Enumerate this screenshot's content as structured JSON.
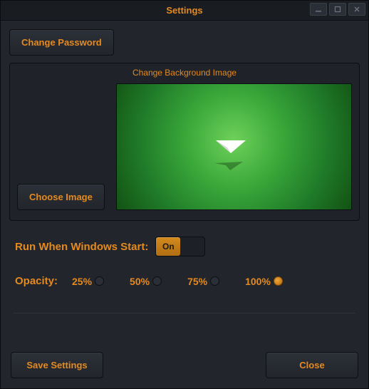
{
  "title": "Settings",
  "change_password_label": "Change Password",
  "bg_section_title": "Change Background Image",
  "choose_image_label": "Choose Image",
  "autostart_label": "Run When Windows Start:",
  "toggle_on_label": "On",
  "toggle_state": "on",
  "opacity_label": "Opacity:",
  "opacity_options": [
    "25%",
    "50%",
    "75%",
    "100%"
  ],
  "opacity_selected": "100%",
  "save_label": "Save Settings",
  "close_label": "Close",
  "colors": {
    "accent": "#e58a1f",
    "bg": "#22252b",
    "preview_primary": "#3aa83a"
  }
}
